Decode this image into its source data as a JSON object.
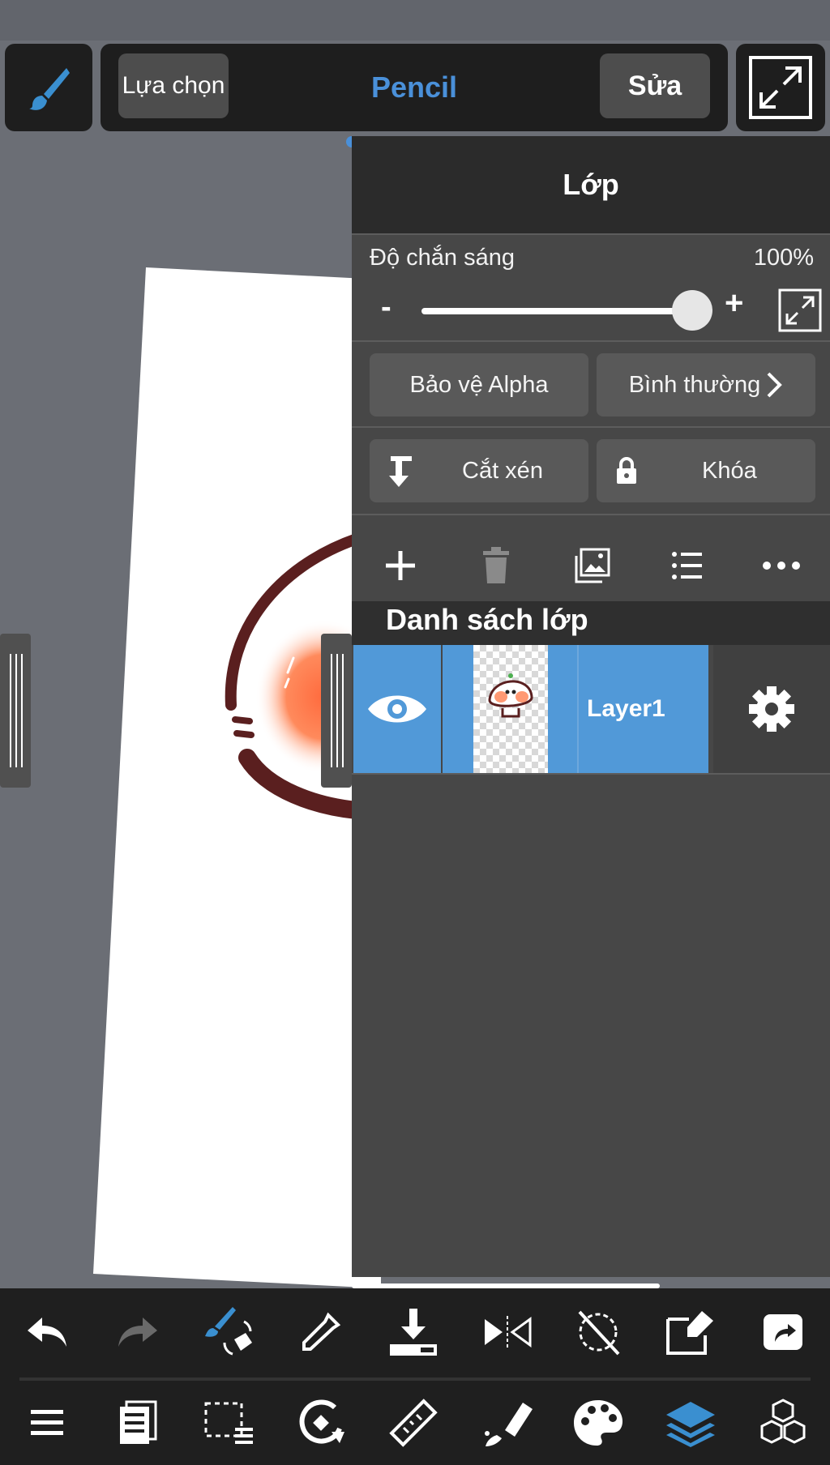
{
  "header": {
    "select_label": "Lựa chọn",
    "tool_name": "Pencil",
    "edit_label": "Sửa"
  },
  "layer_panel": {
    "title": "Lớp",
    "opacity_label": "Độ chắn sáng",
    "opacity_value": "100%",
    "opacity_level": 1.0,
    "minus": "-",
    "plus": "+",
    "alpha_protect_label": "Bảo vệ Alpha",
    "blend_mode_label": "Bình thường",
    "clipping_label": "Cắt xén",
    "lock_label": "Khóa",
    "list_title": "Danh sách lớp",
    "layers": [
      {
        "name": "Layer1",
        "visible": true,
        "selected": true
      }
    ]
  },
  "colors": {
    "accent": "#4a90d9",
    "layer_selected": "#5199d8",
    "panel_bg": "#474747",
    "panel_header": "#2b2b2b",
    "toolbar_bg": "#1f1f1f",
    "brush_stroke": "#5a1f1f",
    "blush": "#ff7f50"
  },
  "icons": {
    "brush": "brush-icon",
    "fullscreen": "expand-icon",
    "add": "plus-icon",
    "delete": "trash-icon",
    "image": "image-icon",
    "list": "list-icon",
    "more": "more-icon",
    "eye": "eye-icon",
    "settings": "gear-icon"
  }
}
